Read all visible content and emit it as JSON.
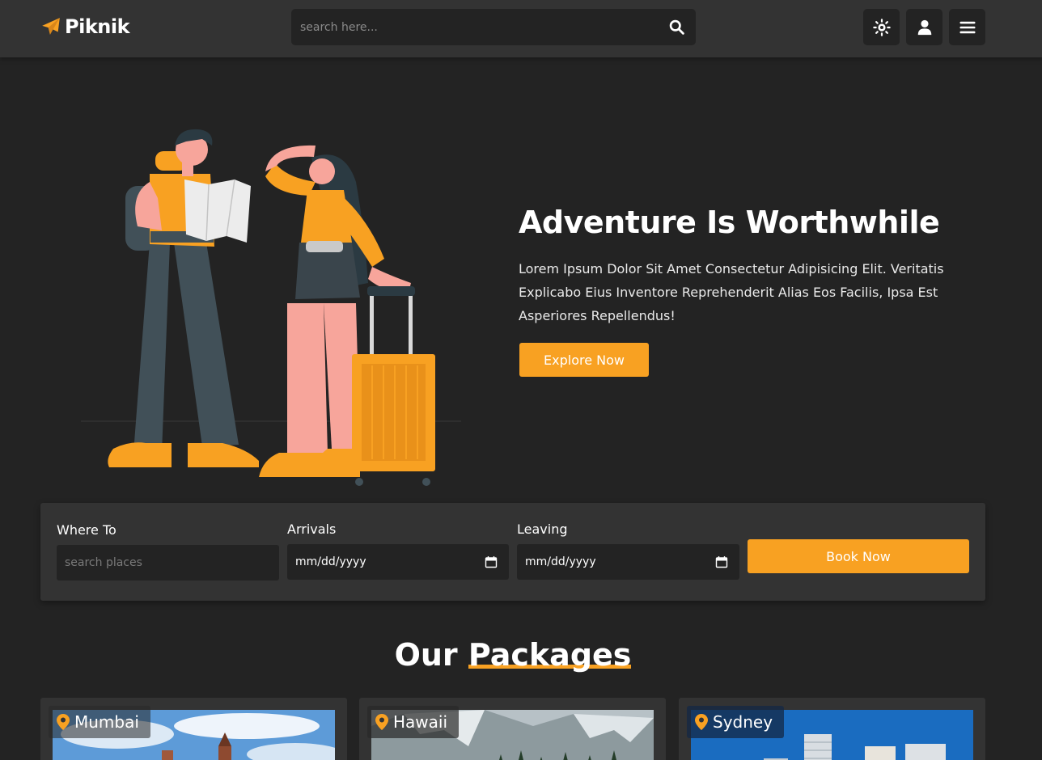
{
  "header": {
    "logo_text": "Piknik",
    "search_placeholder": "search here...",
    "icons": [
      "search-icon",
      "sun-icon",
      "user-icon",
      "menu-icon"
    ]
  },
  "hero": {
    "title": "Adventure Is Worthwhile",
    "text": "Lorem Ipsum Dolor Sit Amet Consectetur Adipisicing Elit. Veritatis Explicabo Eius Inventore Reprehenderit Alias Eos Facilis, Ipsa Est Asperiores Repellendus!",
    "button_label": "Explore Now"
  },
  "booking": {
    "where_label": "Where To",
    "where_placeholder": "search places",
    "arrivals_label": "Arrivals",
    "arrivals_value": "mm/dd/yyyy",
    "leaving_label": "Leaving",
    "leaving_value": "mm/dd/yyyy",
    "book_label": "Book Now"
  },
  "packages": {
    "title_plain": "Our",
    "title_accent": "Packages",
    "cards": [
      {
        "location": "Mumbai"
      },
      {
        "location": "Hawaii"
      },
      {
        "location": "Sydney"
      }
    ]
  },
  "colors": {
    "accent": "#f8a122",
    "background": "#232323",
    "panel": "#333333"
  }
}
